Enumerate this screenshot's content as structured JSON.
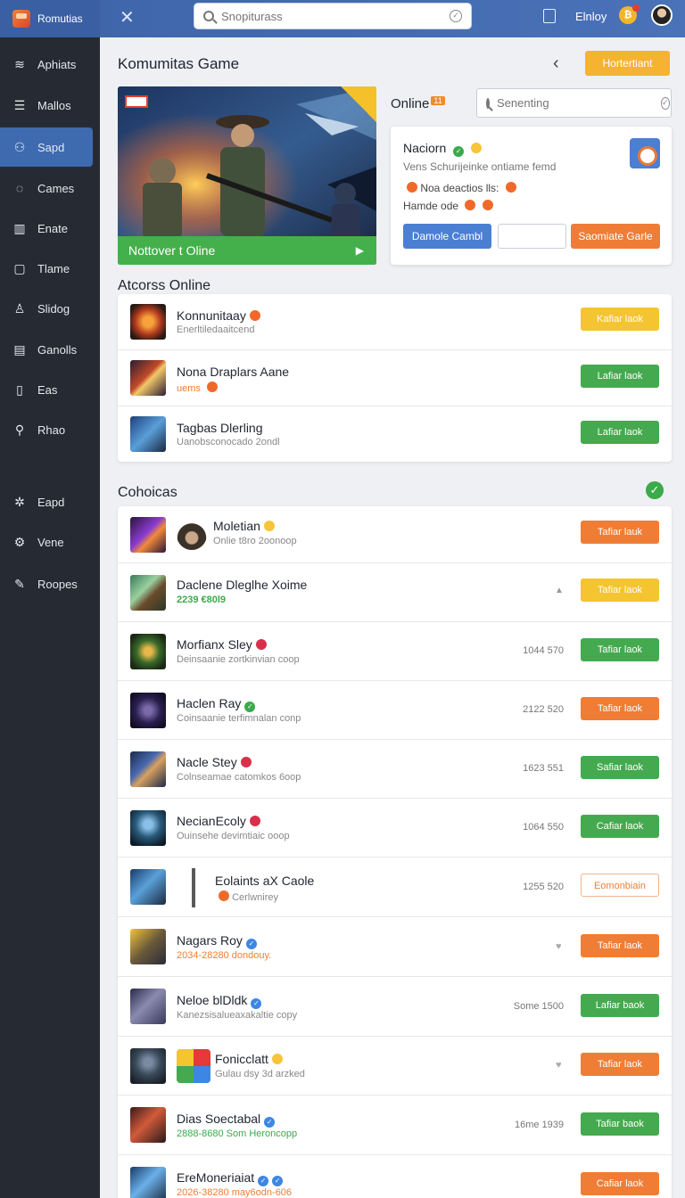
{
  "topbar": {
    "brand": "Romutias",
    "search_placeholder": "Snopiturass",
    "user_label": "Elnloy",
    "notification_icon": "notification-icon"
  },
  "sidebar": {
    "items": [
      {
        "label": "Aphiats",
        "icon": "menu-icon"
      },
      {
        "label": "Mallos",
        "icon": "list-icon"
      },
      {
        "label": "Sapd",
        "icon": "user-icon",
        "active": true
      },
      {
        "label": "Cames",
        "icon": "shield-icon"
      },
      {
        "label": "Enate",
        "icon": "building-icon"
      },
      {
        "label": "Tlame",
        "icon": "chat-icon"
      },
      {
        "label": "Slidog",
        "icon": "person-icon"
      },
      {
        "label": "Ganolls",
        "icon": "chart-icon"
      },
      {
        "label": "Eas",
        "icon": "document-icon"
      },
      {
        "label": "Rhao",
        "icon": "search-icon"
      },
      {
        "label": "Eapd",
        "icon": "settings-icon"
      },
      {
        "label": "Vene",
        "icon": "gear-icon"
      },
      {
        "label": "Roopes",
        "icon": "pencil-icon"
      }
    ]
  },
  "main": {
    "title": "Komumitas Game",
    "top_button": "Hortertiant",
    "hero_caption": "Nottover t Oline",
    "online_label": "Online",
    "online_count": "11",
    "panel_search_placeholder": "Senenting",
    "info": {
      "name": "Naciorn",
      "subtitle": "Vens Schurijeinke ontiame femd",
      "line1": "Noa deactios lls:",
      "line2": "Hamde ode",
      "btn_blue": "Damole Cambl",
      "btn_orange": "Saomiate Garle"
    },
    "section1_title": "Atcorss Online",
    "section1_rows": [
      {
        "title": "Konnunitaay",
        "sub": "Enerltiledaaitcend",
        "btn": "Kafiar laok",
        "btn_color": "yellow",
        "status": "orange"
      },
      {
        "title": "Nona Draplars Aane",
        "sub": "uems",
        "btn": "Lafiar laok",
        "btn_color": "green",
        "status": ""
      },
      {
        "title": "Tagbas Dlerling",
        "sub": "Uanobsconocado 2ondl",
        "btn": "Lafiar laok",
        "btn_color": "green",
        "status": ""
      }
    ],
    "section2_title": "Cohoicas",
    "section2_rows": [
      {
        "title": "Moletian",
        "sub": "Onlie t8ro 2oonoop",
        "meta": "",
        "btn": "Tafiar lauk",
        "btn_color": "orange",
        "status": "yellow"
      },
      {
        "title": "Daclene Dleglhe Xoime",
        "sub": "2239 €80l9",
        "meta": "",
        "btn": "Tafiar laok",
        "btn_color": "yellow",
        "status": ""
      },
      {
        "title": "Morfianx Sley",
        "sub": "Deinsaanie zortkinvian coop",
        "meta": "1044 570",
        "btn": "Tafiar laok",
        "btn_color": "green",
        "status": "red"
      },
      {
        "title": "Haclen Ray",
        "sub": "Coinsaanie terfimnalan conp",
        "meta": "2122 520",
        "btn": "Tafiar laok",
        "btn_color": "orange",
        "status": "green"
      },
      {
        "title": "Nacle Stey",
        "sub": "Colnseamae catomkos 6oop",
        "meta": "1623 551",
        "btn": "Safiar laok",
        "btn_color": "green",
        "status": "red"
      },
      {
        "title": "NecianEcoly",
        "sub": "Ouinsehe devimtiaic ooop",
        "meta": "1064 550",
        "btn": "Cafiar laok",
        "btn_color": "green",
        "status": "red"
      },
      {
        "title": "Eolaints aX Caole",
        "sub": "Cerlwnirey",
        "meta": "1255 520",
        "btn": "Eomonbiain",
        "btn_color": "outline",
        "status": ""
      },
      {
        "title": "Nagars Roy",
        "sub": "2034-28280 dondouy.",
        "meta": "",
        "btn": "Tafiar laok",
        "btn_color": "orange",
        "status": "blue"
      },
      {
        "title": "Neloe blDldk",
        "sub": "Kanezsisalueaxakaltie copy",
        "meta": "Some 1500",
        "btn": "Lafiar baok",
        "btn_color": "green",
        "status": "blue"
      },
      {
        "title": "Fonicclatt",
        "sub": "Gulau dsy 3d arzked",
        "meta": "",
        "btn": "Tafiar laok",
        "btn_color": "orange",
        "status": "yellow"
      },
      {
        "title": "Dias Soectabal",
        "sub": "2888-8680 Som Heroncopp",
        "meta": "16me 1939",
        "btn": "Tafiar baok",
        "btn_color": "green",
        "status": "blue"
      },
      {
        "title": "EreMoneriaiat",
        "sub": "2026-38280 may6odn-606",
        "meta": "",
        "btn": "Cafiar laok",
        "btn_color": "orange",
        "status": "blue"
      }
    ]
  },
  "colors": {
    "topbar": "#4169ad",
    "sidebar": "#262b33",
    "accent_blue": "#3e6ab0",
    "green": "#45aa4f",
    "orange": "#ef7d35",
    "yellow": "#f5c431"
  }
}
